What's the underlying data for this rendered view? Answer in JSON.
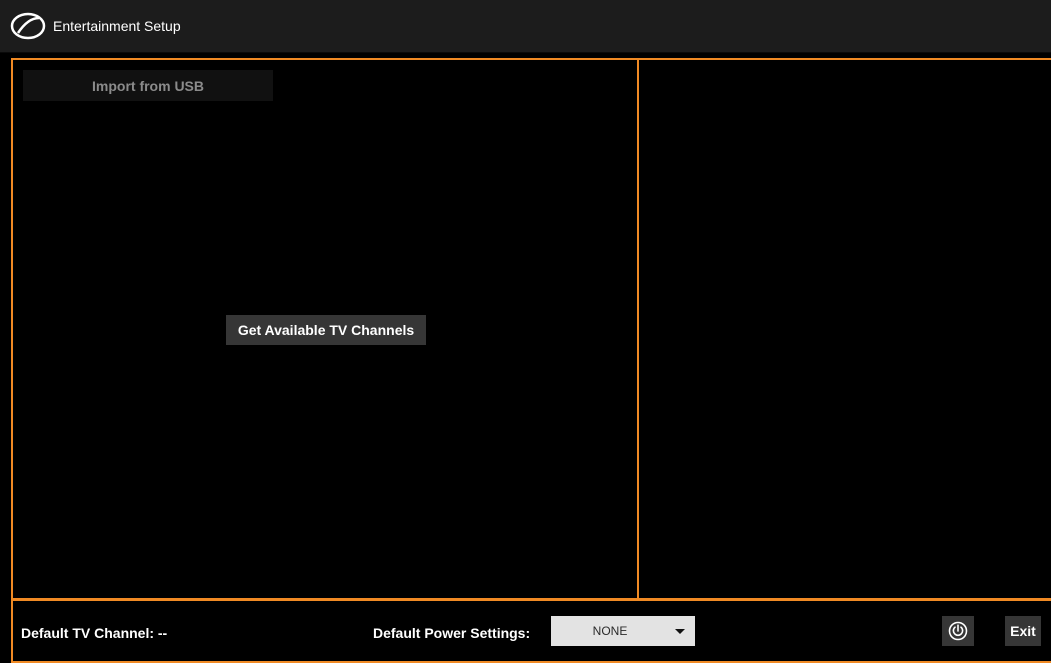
{
  "app": {
    "title": "Entertainment Setup",
    "logo_icon": "app-logo-icon"
  },
  "left_panel": {
    "import_button_label": "Import from USB",
    "get_channels_button_label": "Get Available TV Channels"
  },
  "footer": {
    "default_tv_channel_label": "Default TV Channel: --",
    "default_power_settings_label": "Default Power Settings:",
    "power_select_value": "NONE",
    "power_button_icon": "power-icon",
    "exit_button_label": "Exit"
  },
  "colors": {
    "accent_border": "#f08a24",
    "titlebar_bg": "#1c1c1c",
    "button_bg": "#363636",
    "background": "#000000"
  }
}
